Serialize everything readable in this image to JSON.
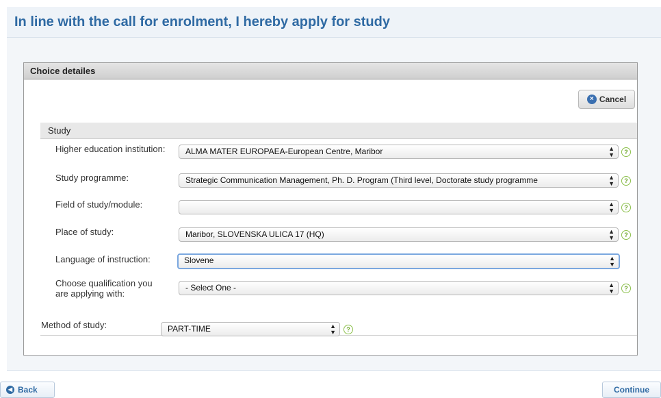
{
  "page": {
    "title": "In line with the call for enrolment, I hereby apply for study"
  },
  "choice": {
    "header": "Choice detailes",
    "cancel_label": "Cancel",
    "study_section": "Study",
    "fields": [
      {
        "label": "Higher education institution:",
        "value": "ALMA MATER EUROPAEA-European Centre, Maribor"
      },
      {
        "label": "Study programme:",
        "value": "Strategic Communication Management, Ph. D. Program (Third level, Doctorate study programme"
      },
      {
        "label": "Field of study/module:",
        "value": ""
      },
      {
        "label": "Place of study:",
        "value": "Maribor, SLOVENSKA ULICA 17 (HQ)"
      },
      {
        "label": "Language of instruction:",
        "value": "Slovene"
      },
      {
        "label_line1": "Choose qualification you",
        "label_line2": "are applying with:",
        "value": "- Select One -"
      }
    ],
    "method": {
      "label": "Method of study:",
      "value": "PART-TIME"
    }
  },
  "footer": {
    "back_label": "Back",
    "continue_label": "Continue"
  },
  "icons": {
    "cancel": "x-circle-icon",
    "help": "help-icon",
    "back": "arrow-left-icon",
    "select": "up-down-arrows-icon"
  },
  "colors": {
    "title": "#2f6aa3",
    "help": "#8cc04b",
    "focus": "#7aa7df"
  }
}
